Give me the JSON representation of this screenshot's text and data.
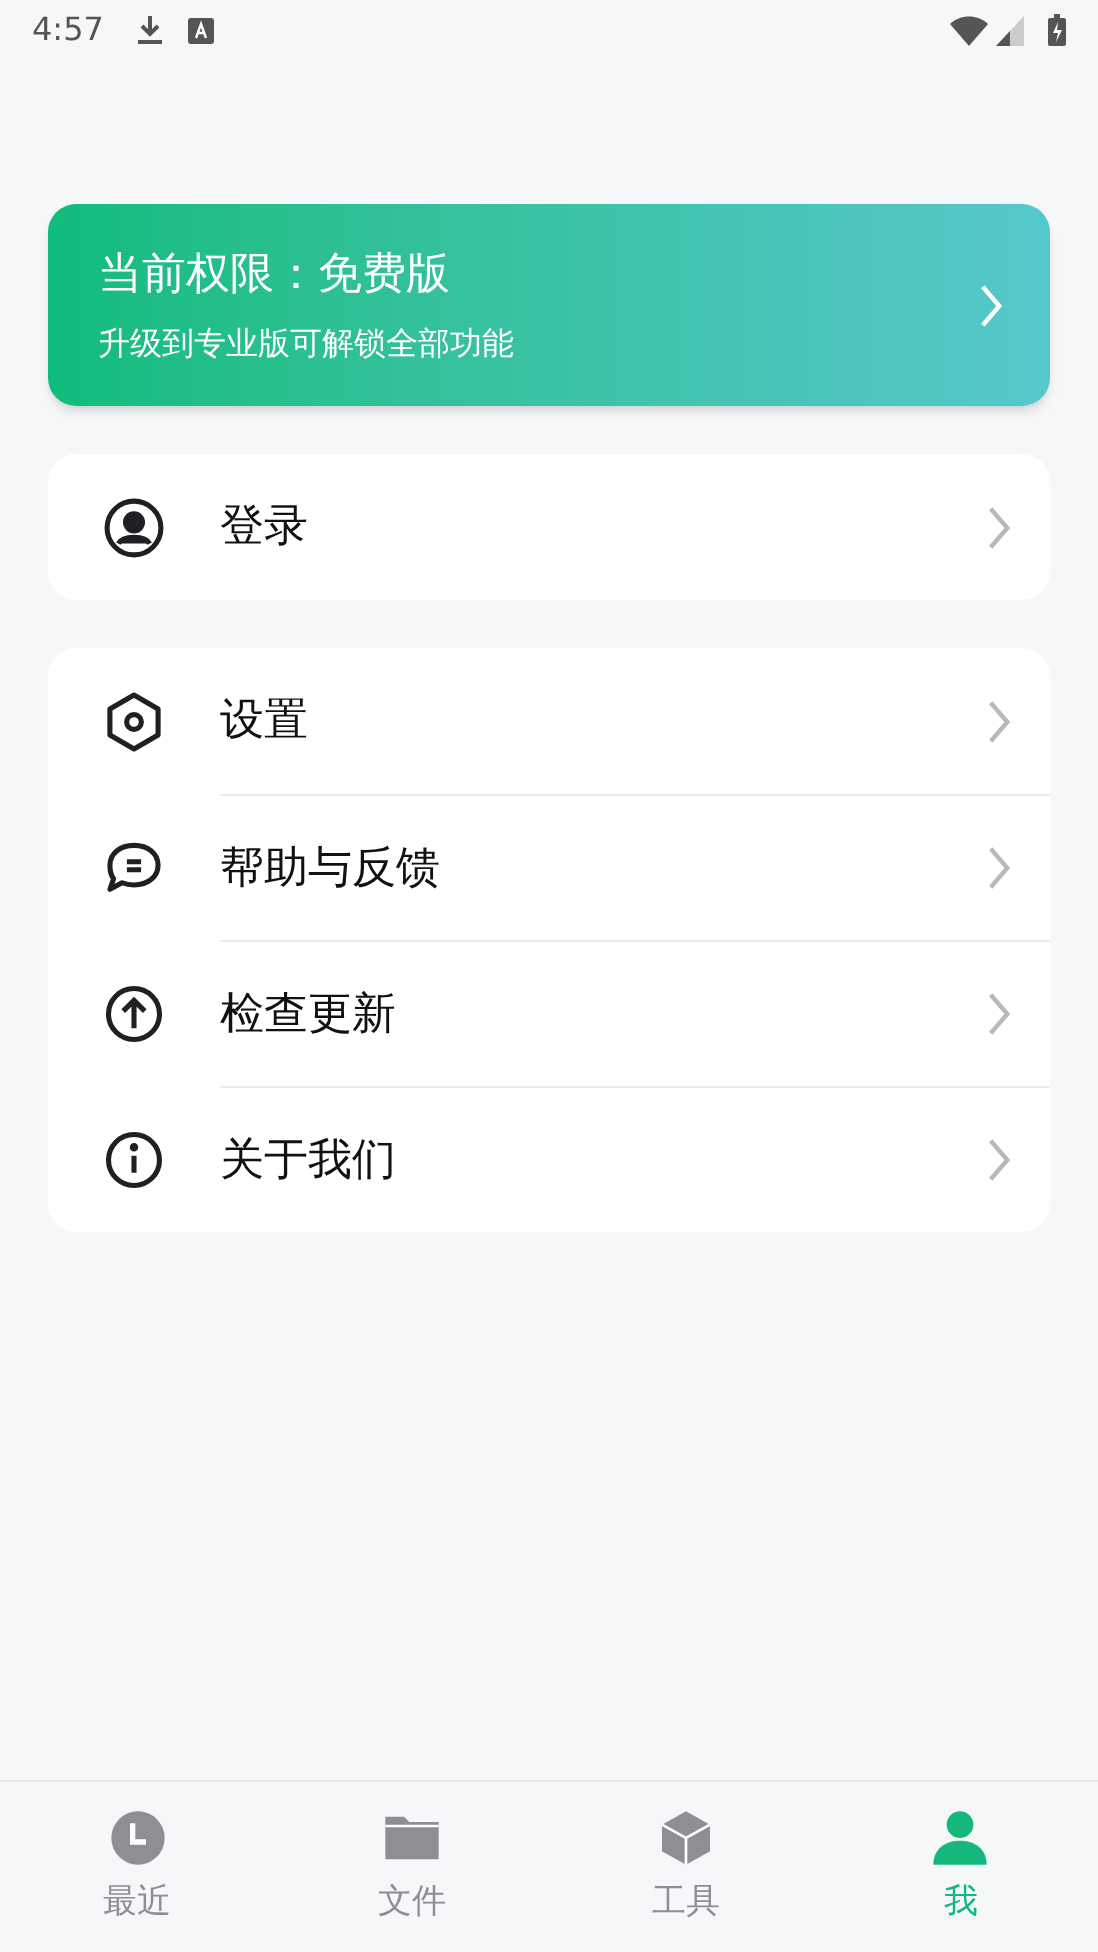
{
  "status_bar": {
    "time": "4:57"
  },
  "upgrade_banner": {
    "title": "当前权限：免费版",
    "subtitle": "升级到专业版可解锁全部功能"
  },
  "account_card": [
    {
      "kind": "user",
      "label": "登录"
    }
  ],
  "menu_card": [
    {
      "kind": "settings",
      "label": "设置"
    },
    {
      "kind": "chat",
      "label": "帮助与反馈"
    },
    {
      "kind": "update",
      "label": "检查更新"
    },
    {
      "kind": "info",
      "label": "关于我们"
    }
  ],
  "bottom_nav": [
    {
      "kind": "clock",
      "label": "最近",
      "selected": false
    },
    {
      "kind": "folder",
      "label": "文件",
      "selected": false
    },
    {
      "kind": "tools",
      "label": "工具",
      "selected": false
    },
    {
      "kind": "person",
      "label": "我",
      "selected": true
    }
  ]
}
